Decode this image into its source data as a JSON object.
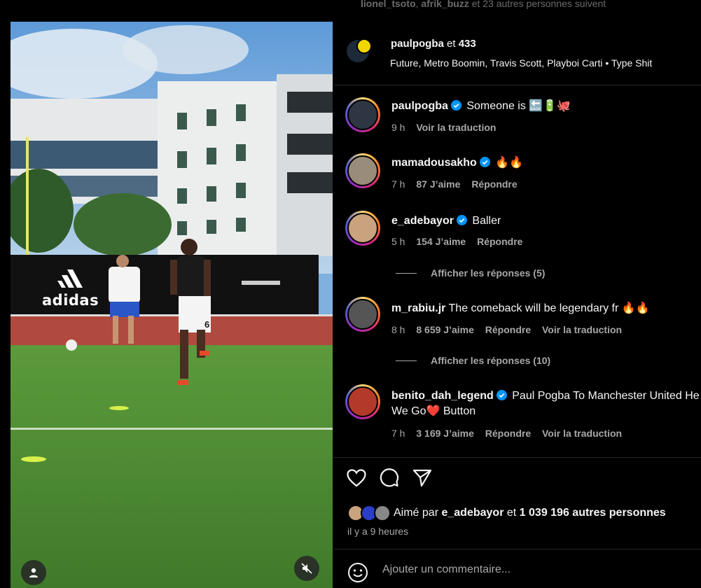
{
  "top": {
    "followed_user_1": "lionel_tsoto",
    "followed_user_2": "afrik_buzz",
    "followed_rest": "et 23 autres personnes suivent"
  },
  "header": {
    "author": "paulpogba",
    "joiner": "et",
    "coauthor": "433",
    "music_artists": "Future, Metro Boomin, Travis Scott, Playboi Carti",
    "music_separator": "•",
    "music_title": "Type Shit"
  },
  "video": {
    "brand_text": "adidas",
    "jersey_number": "6"
  },
  "comments": [
    {
      "user": "paulpogba",
      "verified": true,
      "text": "Someone is 🔙🔋🐙",
      "time": "9 h",
      "likes": "",
      "reply": "",
      "translate": "Voir la traduction"
    },
    {
      "user": "mamadousakho",
      "verified": true,
      "text": "🔥🔥",
      "time": "7 h",
      "likes": "87 J’aime",
      "reply": "Répondre",
      "translate": ""
    },
    {
      "user": "e_adebayor",
      "verified": true,
      "text": "Baller",
      "time": "5 h",
      "likes": "154 J’aime",
      "reply": "Répondre",
      "translate": ""
    },
    {
      "user": "m_rabiu.jr",
      "verified": false,
      "text": "The comeback will be legendary fr 🔥🔥",
      "time": "8 h",
      "likes": "8 659 J’aime",
      "reply": "Répondre",
      "translate": "Voir la traduction"
    },
    {
      "user": "benito_dah_legend",
      "verified": true,
      "text": "Paul Pogba To Manchester United Here",
      "text2": "We Go❤️  Button",
      "time": "7 h",
      "likes": "3 169 J’aime",
      "reply": "Répondre",
      "translate": "Voir la traduction"
    }
  ],
  "replies": {
    "show_1": "Afficher les réponses (5)",
    "show_2": "Afficher les réponses (10)"
  },
  "likes_line": {
    "prefix": "Aimé par",
    "user": "e_adebayor",
    "joiner": "et",
    "others": "1 039 196 autres personnes"
  },
  "posted_ago": "il y a 9 heures",
  "comment_input": {
    "placeholder": "Ajouter un commentaire..."
  },
  "colors": {
    "background": "#000000",
    "secondary_text": "#a8a8a8",
    "verified": "#0095f6",
    "divider": "#262626"
  },
  "icons": [
    "user-tag-icon",
    "mute-icon",
    "verified-icon",
    "heart-icon",
    "comment-icon",
    "share-icon",
    "emoji-icon"
  ]
}
